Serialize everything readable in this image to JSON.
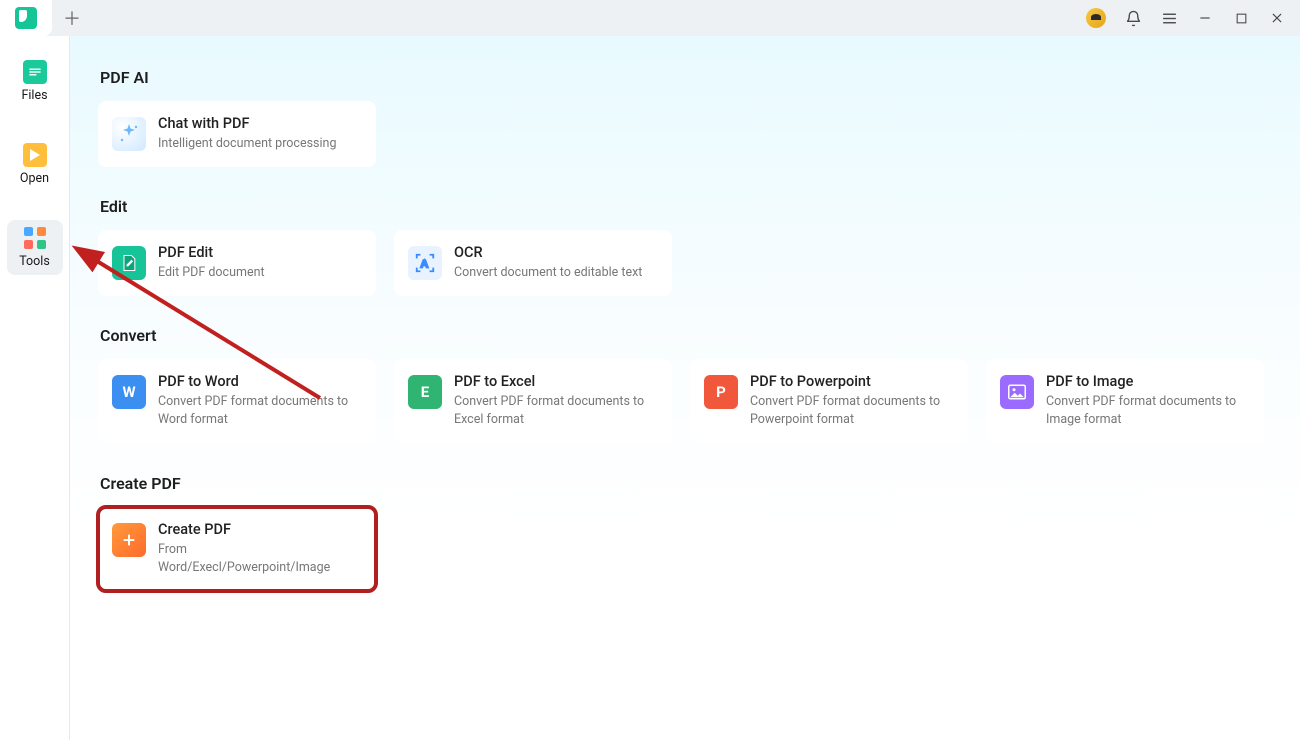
{
  "sidebar": {
    "items": [
      {
        "label": "Files"
      },
      {
        "label": "Open"
      },
      {
        "label": "Tools"
      }
    ]
  },
  "sections": {
    "pdf_ai": {
      "title": "PDF AI",
      "cards": [
        {
          "title": "Chat with PDF",
          "desc": "Intelligent document processing"
        }
      ]
    },
    "edit": {
      "title": "Edit",
      "cards": [
        {
          "title": "PDF Edit",
          "desc": "Edit PDF document"
        },
        {
          "title": "OCR",
          "desc": "Convert document to editable text"
        }
      ]
    },
    "convert": {
      "title": "Convert",
      "cards": [
        {
          "title": "PDF to Word",
          "desc": "Convert PDF format documents to Word format"
        },
        {
          "title": "PDF to Excel",
          "desc": "Convert PDF format documents to Excel format"
        },
        {
          "title": "PDF to Powerpoint",
          "desc": "Convert PDF format documents to Powerpoint format"
        },
        {
          "title": "PDF to Image",
          "desc": "Convert PDF format documents to Image format"
        }
      ]
    },
    "create": {
      "title": "Create PDF",
      "cards": [
        {
          "title": "Create PDF",
          "desc": "From Word/Execl/Powerpoint/Image"
        }
      ]
    }
  }
}
